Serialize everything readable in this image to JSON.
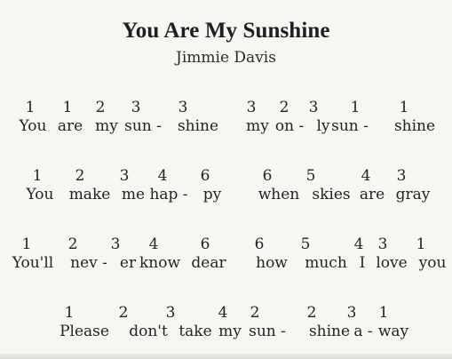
{
  "song": {
    "title": "You Are My Sunshine",
    "composer": "Jimmie Davis"
  },
  "lines": [
    {
      "numbers": [
        "1",
        "1",
        "2",
        "3",
        "3",
        "3",
        "2",
        "3",
        "1",
        "1"
      ],
      "syllables": [
        "You",
        "are",
        "my",
        "sun -",
        "shine",
        "my",
        "on -",
        "ly",
        "sun -",
        "shine"
      ]
    },
    {
      "numbers": [
        "1",
        "2",
        "3",
        "4",
        "6",
        "6",
        "5",
        "4",
        "3"
      ],
      "syllables": [
        "You",
        "make",
        "me",
        "hap -",
        "py",
        "when",
        "skies",
        "are",
        "gray"
      ]
    },
    {
      "numbers": [
        "1",
        "2",
        "3",
        "4",
        "6",
        "6",
        "5",
        "4",
        "3",
        "1"
      ],
      "syllables": [
        "You'll",
        "nev -",
        "er",
        "know",
        "dear",
        "how",
        "much",
        "I",
        "love",
        "you"
      ]
    },
    {
      "numbers": [
        "1",
        "2",
        "3",
        "4",
        "2",
        "2",
        "3",
        "1"
      ],
      "syllables": [
        "Please",
        "don't",
        "take",
        "my",
        "sun -",
        "shine",
        "a -",
        "way"
      ]
    }
  ]
}
